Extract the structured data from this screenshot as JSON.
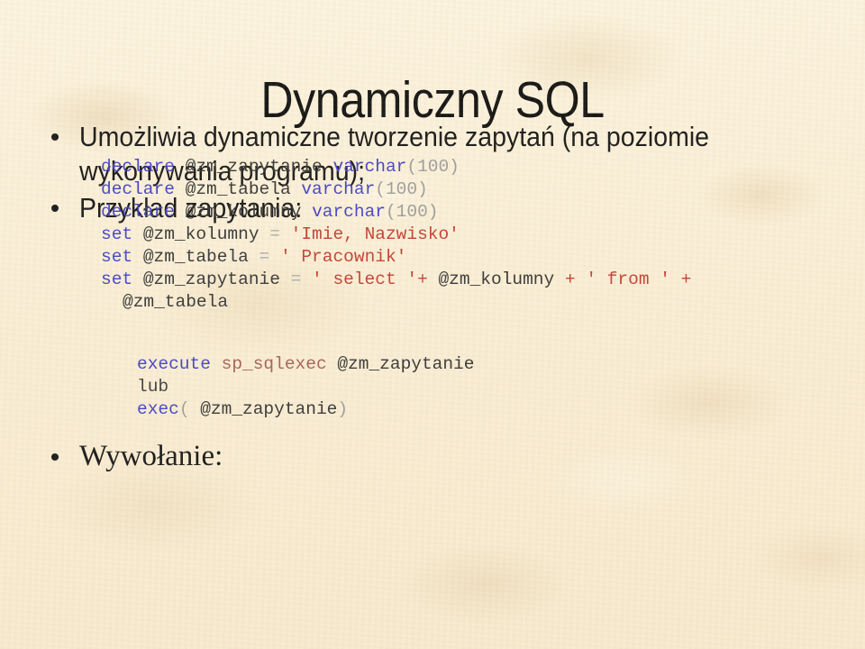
{
  "slide": {
    "title": "Dynamiczny SQL",
    "background_color": "#faefd7",
    "title_color": "#0a0a0a"
  },
  "bullets": [
    {
      "marker": "•",
      "text": "Umożliwia dynamiczne tworzenie zapytań (na poziomie wykonywania programu);"
    },
    {
      "marker": "•",
      "text": "Przykład zapytania:"
    },
    {
      "marker": "•",
      "text": "Wywołanie:"
    }
  ],
  "code_declare": {
    "lines": [
      {
        "tokens": [
          {
            "t": "declare ",
            "c": "keyword"
          },
          {
            "t": "@zm_zapytanie ",
            "c": "variable"
          },
          {
            "t": "varchar",
            "c": "keyword"
          },
          {
            "t": "(100)",
            "c": "number"
          }
        ]
      },
      {
        "tokens": [
          {
            "t": "declare ",
            "c": "keyword"
          },
          {
            "t": "@zm_tabela ",
            "c": "variable"
          },
          {
            "t": "varchar",
            "c": "keyword"
          },
          {
            "t": "(100)",
            "c": "number"
          }
        ]
      },
      {
        "tokens": [
          {
            "t": "declare ",
            "c": "keyword"
          },
          {
            "t": "@zm_kolumny ",
            "c": "variable"
          },
          {
            "t": "varchar",
            "c": "keyword"
          },
          {
            "t": "(100)",
            "c": "number"
          }
        ]
      },
      {
        "tokens": [
          {
            "t": "set ",
            "c": "keyword"
          },
          {
            "t": "@zm_kolumny ",
            "c": "variable"
          },
          {
            "t": "= ",
            "c": "operator"
          },
          {
            "t": "'Imie, Nazwisko'",
            "c": "string"
          }
        ]
      },
      {
        "tokens": [
          {
            "t": "set ",
            "c": "keyword"
          },
          {
            "t": "@zm_tabela ",
            "c": "variable"
          },
          {
            "t": "= ",
            "c": "operator"
          },
          {
            "t": "' Pracownik'",
            "c": "string"
          }
        ]
      },
      {
        "tokens": [
          {
            "t": "set ",
            "c": "keyword"
          },
          {
            "t": "@zm_zapytanie ",
            "c": "variable"
          },
          {
            "t": "= ",
            "c": "operator"
          },
          {
            "t": "' select '",
            "c": "string"
          },
          {
            "t": "+ ",
            "c": "plus"
          },
          {
            "t": "@zm_kolumny ",
            "c": "variable"
          },
          {
            "t": "+ ",
            "c": "plus"
          },
          {
            "t": "' from ' ",
            "c": "string"
          },
          {
            "t": "+",
            "c": "plus"
          }
        ]
      },
      {
        "continuation": true,
        "tokens": [
          {
            "t": "@zm_tabela",
            "c": "variable"
          }
        ]
      }
    ]
  },
  "code_execute": {
    "lines": [
      {
        "tokens": [
          {
            "t": "execute ",
            "c": "keyword"
          },
          {
            "t": "sp_sqlexec ",
            "c": "procedure"
          },
          {
            "t": "@zm_zapytanie",
            "c": "variable"
          }
        ]
      },
      {
        "tokens": [
          {
            "t": "lub",
            "c": "plain"
          }
        ]
      },
      {
        "tokens": [
          {
            "t": "exec",
            "c": "keyword"
          },
          {
            "t": "( ",
            "c": "paren"
          },
          {
            "t": "@zm_zapytanie",
            "c": "variable"
          },
          {
            "t": ")",
            "c": "paren"
          }
        ]
      }
    ]
  },
  "colors": {
    "keyword": "#3c3cc6",
    "string": "#c0392b",
    "number": "#9a9a9a",
    "variable": "#2f2f2f",
    "procedure": "#a35a55",
    "operator": "#a8a8a8"
  }
}
